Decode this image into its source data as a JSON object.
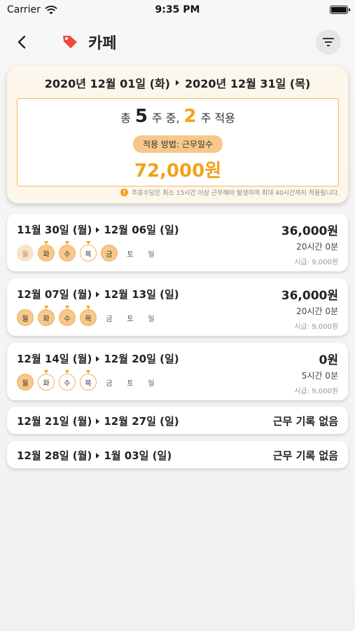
{
  "status_bar": {
    "carrier": "Carrier",
    "time": "9:35 PM"
  },
  "nav": {
    "title": "카페"
  },
  "summary": {
    "start": "2020년 12월 01일 (화)",
    "end": "2020년 12월 31일 (목)",
    "prefix": "총",
    "total_weeks": "5",
    "mid": "주 중,",
    "applied_weeks": "2",
    "suffix": "주 적용",
    "method": "적용 방법: 근무일수",
    "total_amount": "72,000원",
    "note": "주휴수당은 최소 15시간 이상 근무해야 발생하며 최대 40시간까지 적용됩니다."
  },
  "day_labels": [
    "월",
    "화",
    "수",
    "목",
    "금",
    "토",
    "일"
  ],
  "weeks": [
    {
      "start": "11월 30일 (월)",
      "end": "12월 06일 (일)",
      "amount": "36,000원",
      "hours": "20시간 0분",
      "wage": "시급: 9,000원",
      "days": [
        "light",
        "filled-pin",
        "filled-pin",
        "outline-pin",
        "filled",
        "empty",
        "empty"
      ]
    },
    {
      "start": "12월 07일 (월)",
      "end": "12월 13일 (일)",
      "amount": "36,000원",
      "hours": "20시간 0분",
      "wage": "시급: 9,000원",
      "days": [
        "filled",
        "filled-pin",
        "filled-pin",
        "filled-pin",
        "empty",
        "empty",
        "empty"
      ]
    },
    {
      "start": "12월 14일 (월)",
      "end": "12월 20일 (일)",
      "amount": "0원",
      "hours": "5시간 0분",
      "wage": "시급: 9,000원",
      "days": [
        "filled",
        "outline-pin",
        "outline-pin",
        "outline-pin",
        "empty",
        "empty",
        "empty"
      ]
    },
    {
      "start": "12월 21일 (월)",
      "end": "12월 27일 (일)",
      "no_record": "근무 기록 없음"
    },
    {
      "start": "12월 28일 (월)",
      "end": "1월 03일 (일)",
      "no_record": "근무 기록 없음"
    }
  ],
  "colors": {
    "accent": "#f2a21a",
    "badge": "#f6c88a",
    "card_bg": "#fdf6ea"
  }
}
